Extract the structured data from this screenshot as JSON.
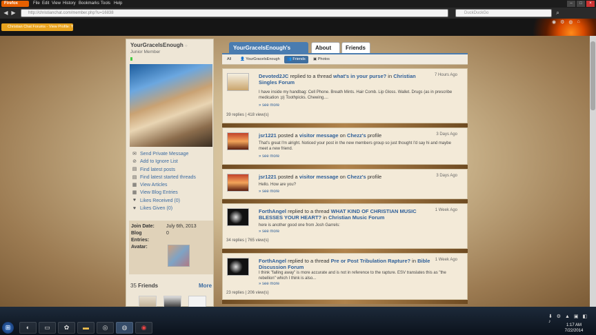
{
  "browser": {
    "firefox_label": "Firefox",
    "menu": [
      "File",
      "Edit",
      "View",
      "History",
      "Bookmarks",
      "Tools",
      "Help"
    ],
    "url": "http://christianchat.com/member.php?u=16838",
    "search_placeholder": "DuckDuckGo",
    "tab_title": "Christian Chat Forums - View Profile: YourGraceIsEnough"
  },
  "profile": {
    "username": "YourGraceIsEnough",
    "status_dot": "○",
    "user_title": "Junior Member",
    "links": [
      {
        "label": "Send Private Message",
        "icon": "envelope-icon",
        "glyph": "✉"
      },
      {
        "label": "Add to Ignore List",
        "icon": "ignore-icon",
        "glyph": "⊘"
      },
      {
        "label": "Find latest posts",
        "icon": "posts-icon",
        "glyph": "▤"
      },
      {
        "label": "Find latest started threads",
        "icon": "threads-icon",
        "glyph": "▤"
      },
      {
        "label": "View Articles",
        "icon": "articles-icon",
        "glyph": "▦"
      },
      {
        "label": "View Blog Entries",
        "icon": "blog-icon",
        "glyph": "▦"
      },
      {
        "label": "Likes Received (0)",
        "icon": "heart-icon",
        "glyph": "♥"
      },
      {
        "label": "Likes Given (0)",
        "icon": "heart-icon",
        "glyph": "♥"
      }
    ],
    "join_date_label": "Join Date:",
    "join_date": "July 6th, 2013",
    "blog_label": "Blog",
    "entries_label": "Entries:",
    "entries": "0",
    "avatar_label": "Avatar:",
    "friends_count": "35",
    "friends_label": "Friends",
    "friends_more": "More"
  },
  "tabs": [
    {
      "label": "YourGraceIsEnough's Activity",
      "active": true
    },
    {
      "label": "About Me",
      "active": false
    },
    {
      "label": "Friends",
      "active": false
    }
  ],
  "subtabs": [
    {
      "label": "All"
    },
    {
      "label": "YourGraceIsEnough",
      "icon": "user-icon",
      "glyph": "👤"
    },
    {
      "label": "Friends",
      "icon": "friends-icon",
      "glyph": "👥"
    },
    {
      "label": "Photos",
      "icon": "photos-icon",
      "glyph": "▣"
    }
  ],
  "activity": [
    {
      "user": "Devoted2JC",
      "action": " replied to a thread ",
      "link": "what's in your purse?",
      "mid": " in ",
      "link2": "Christian Singles Forum",
      "time": "7 Hours Ago",
      "body": "I have inside my handbag: Cell Phone. Breath Mints. Hair Comb. Lip Gloss. Wallet. Drugs (as in prescribe medication :p) Toothpicks. Chewing....",
      "more": "» see more",
      "replies": "39 replies | 418 view(s)"
    },
    {
      "user": "jsr1221",
      "action": " posted a ",
      "link": "visitor message",
      "mid": " on ",
      "link2": "Chezz's",
      "tail": " profile",
      "time": "3 Days Ago",
      "body": "That's great I'm alright. Noticed your post in the new members group so just thought I'd say hi and maybe meet a new friend.",
      "more": "» see more"
    },
    {
      "user": "jsr1221",
      "action": " posted a ",
      "link": "visitor message",
      "mid": " on ",
      "link2": "Chezz's",
      "tail": " profile",
      "time": "3 Days Ago",
      "body": "Hello. How are you?",
      "more": "» see more"
    },
    {
      "user": "ForthAngel",
      "action": " replied to a thread ",
      "link": "WHAT KIND OF CHRISTIAN MUSIC BLESSES YOUR HEART?",
      "mid": " in ",
      "link2": "Christian Music Forum",
      "time": "1 Week Ago",
      "body": "here is another good one from Josh Garrels:",
      "more": "» see more",
      "replies": "34 replies | 765 view(s)"
    },
    {
      "user": "ForthAngel",
      "action": " replied to a thread ",
      "link": "Pre or Post Tribulation Rapture?",
      "mid": " in ",
      "link2": "Bible Discussion Forum",
      "time": "1 Week Ago",
      "body": "I think \"falling away\" is more accurate and is not in reference to the rapture. ESV translates this as \"the rebellion\" which I think is also...",
      "more": "» see more",
      "replies": "23 replies | 206 view(s)"
    }
  ],
  "taskbar": {
    "start_glyph": "⊞",
    "tray_icons": "⬇ ⚙ ▲ ▣ ◧ ♪",
    "time": "1:17 AM",
    "date": "7/22/2014"
  }
}
